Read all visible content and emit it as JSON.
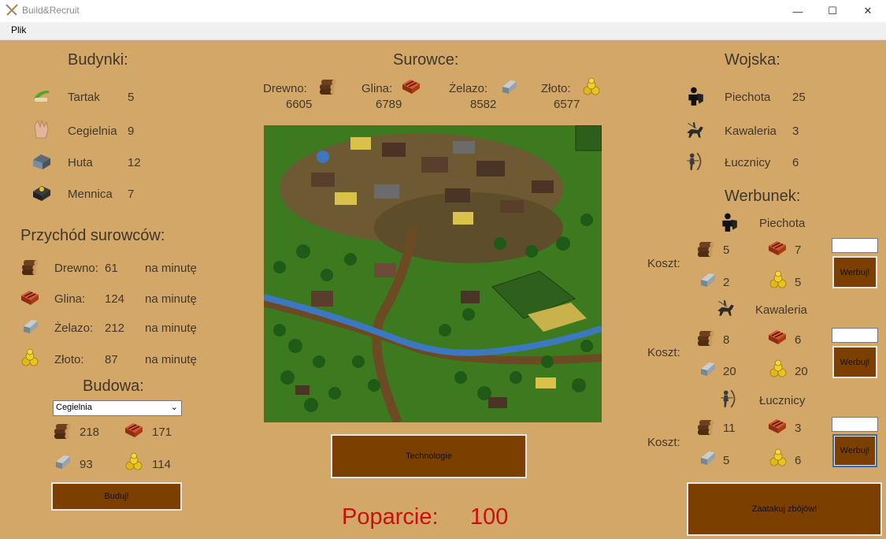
{
  "window": {
    "title": "Build&Recruit",
    "minimize": "—",
    "maximize": "☐",
    "close": "✕"
  },
  "menu": {
    "file": "Plik"
  },
  "buildings": {
    "header": "Budynki:",
    "items": [
      {
        "name": "Tartak",
        "value": "5",
        "icon": "sawmill-icon"
      },
      {
        "name": "Cegielnia",
        "value": "9",
        "icon": "brickyard-icon"
      },
      {
        "name": "Huta",
        "value": "12",
        "icon": "smelter-icon"
      },
      {
        "name": "Mennica",
        "value": "7",
        "icon": "mint-icon"
      }
    ]
  },
  "income": {
    "header": "Przychód surowców:",
    "items": [
      {
        "label": "Drewno:",
        "value": "61",
        "unit": "na minutę",
        "icon": "wood-icon"
      },
      {
        "label": "Glina:",
        "value": "124",
        "unit": "na minutę",
        "icon": "clay-icon"
      },
      {
        "label": "Żelazo:",
        "value": "212",
        "unit": "na minutę",
        "icon": "iron-icon"
      },
      {
        "label": "Złoto:",
        "value": "87",
        "unit": "na minutę",
        "icon": "gold-icon"
      }
    ]
  },
  "build": {
    "header": "Budowa:",
    "selected": "Cegielnia",
    "cost": {
      "wood": "218",
      "clay": "171",
      "iron": "93",
      "gold": "114"
    },
    "button": "Buduj!"
  },
  "resources": {
    "header": "Surowce:",
    "items": [
      {
        "label": "Drewno:",
        "value": "6605",
        "icon": "wood-icon"
      },
      {
        "label": "Glina:",
        "value": "6789",
        "icon": "clay-icon"
      },
      {
        "label": "Żelazo:",
        "value": "8582",
        "icon": "iron-icon"
      },
      {
        "label": "Złoto:",
        "value": "6577",
        "icon": "gold-icon"
      }
    ]
  },
  "technology_button": "Technologie",
  "support": {
    "label": "Poparcie:",
    "value": "100"
  },
  "army": {
    "header": "Wojska:",
    "items": [
      {
        "name": "Piechota",
        "value": "25",
        "icon": "infantry-icon"
      },
      {
        "name": "Kawaleria",
        "value": "3",
        "icon": "cavalry-icon"
      },
      {
        "name": "Łucznicy",
        "value": "6",
        "icon": "archer-icon"
      }
    ]
  },
  "recruit": {
    "header": "Werbunek:",
    "cost_label": "Koszt:",
    "button": "Werbuj!",
    "units": [
      {
        "name": "Piechota",
        "wood": "5",
        "clay": "7",
        "iron": "2",
        "gold": "5",
        "amount": ""
      },
      {
        "name": "Kawaleria",
        "wood": "8",
        "clay": "6",
        "iron": "20",
        "gold": "20",
        "amount": ""
      },
      {
        "name": "Łucznicy",
        "wood": "11",
        "clay": "3",
        "iron": "5",
        "gold": "6",
        "amount": ""
      }
    ]
  },
  "attack_button": "Zaatakuj zbójów!",
  "colors": {
    "panel": "#d2a767",
    "button": "#7b3f00",
    "support": "#c91010",
    "text": "#41362a"
  }
}
